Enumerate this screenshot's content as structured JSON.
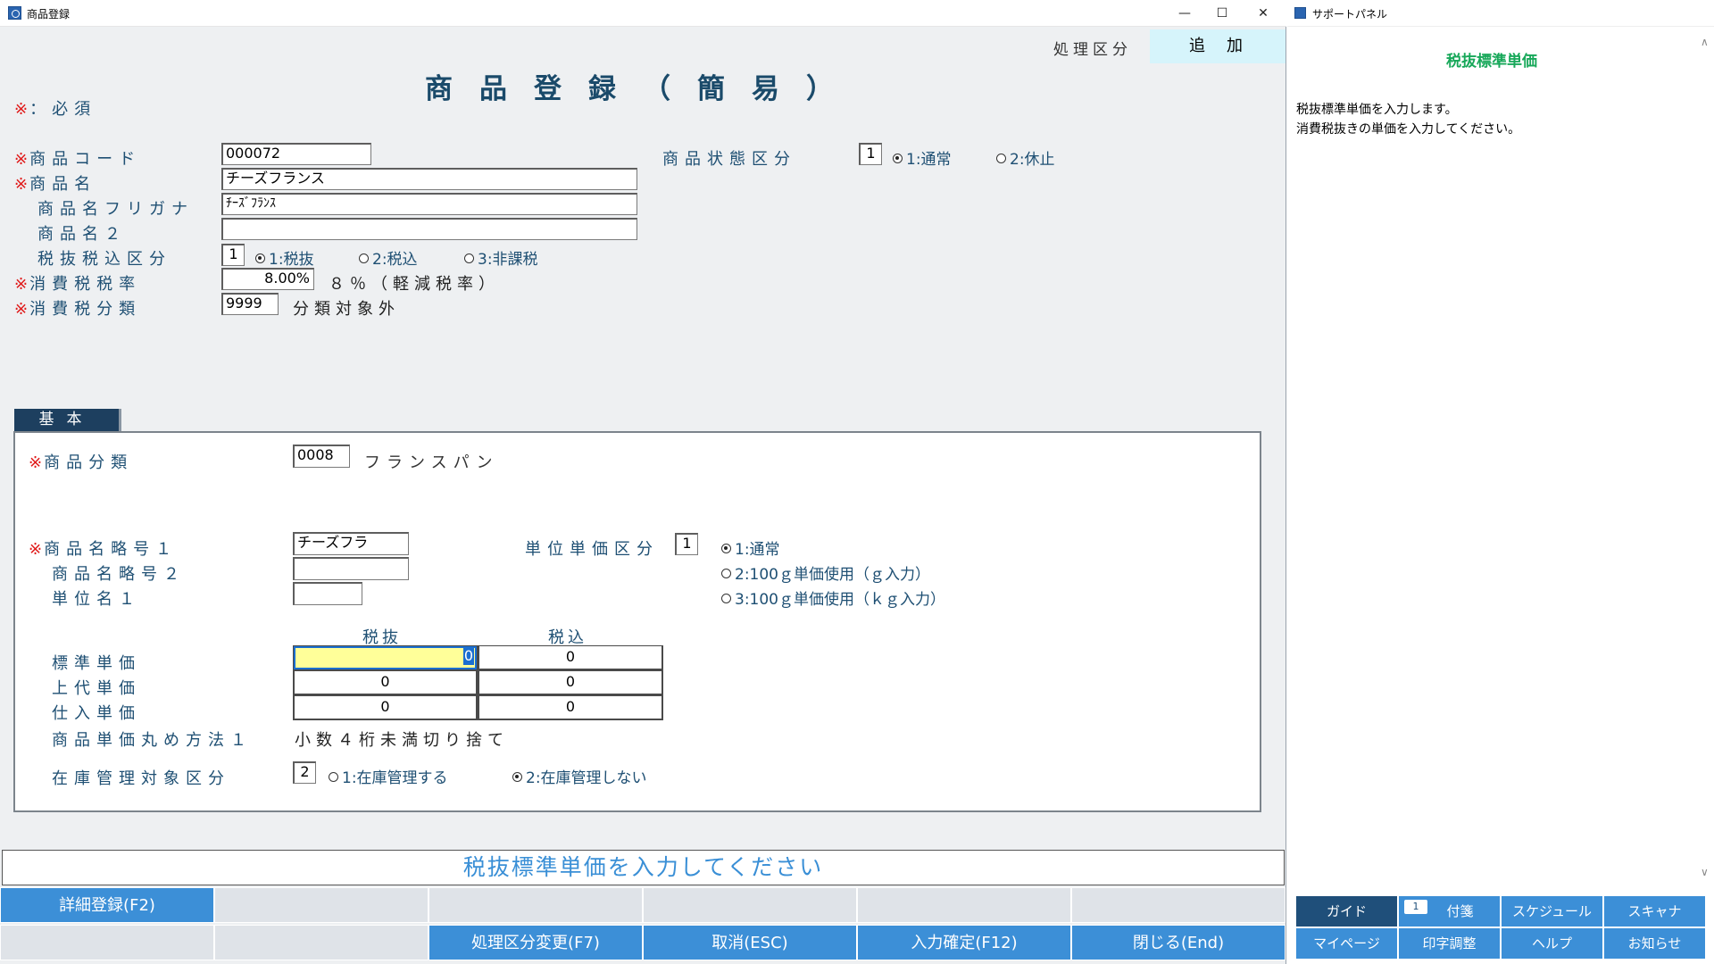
{
  "window": {
    "title": "商品登録"
  },
  "mode": {
    "label": "処理区分",
    "value": "追加"
  },
  "form_title": "商品登録（簡易）",
  "required_note": "：必須",
  "required_mark": "※",
  "header_fields": {
    "code_label": "商品コード",
    "code_value": "000072",
    "name_label": "商品名",
    "name_value": "チーズフランス",
    "kana_label": "商品名フリガナ",
    "kana_value": "ﾁｰｽﾞﾌﾗﾝｽ",
    "name2_label": "商品名２",
    "name2_value": "",
    "taxmode_label": "税抜税込区分",
    "taxmode_value": "1",
    "taxmode_opt1": "1:税抜",
    "taxmode_opt2": "2:税込",
    "taxmode_opt3": "3:非課税",
    "taxrate_label": "消費税税率",
    "taxrate_value": "8.00%",
    "taxrate_desc": "８％（軽減税率）",
    "taxcat_label": "消費税分類",
    "taxcat_value": "9999",
    "taxcat_desc": "分類対象外",
    "status_label": "商品状態区分",
    "status_value": "1",
    "status_opt1": "1:通常",
    "status_opt2": "2:休止"
  },
  "tab": {
    "label": "基本"
  },
  "basic": {
    "category_label": "商品分類",
    "category_value": "0008",
    "category_desc": "フランスパン",
    "abbr1_label": "商品名略号１",
    "abbr1_value": "チーズフラ",
    "abbr2_label": "商品名略号２",
    "abbr2_value": "",
    "unit1_label": "単位名１",
    "unit1_value": "",
    "unitprice_label": "単位単価区分",
    "unitprice_value": "1",
    "unitprice_opt1": "1:通常",
    "unitprice_opt2": "2:100ｇ単価使用（ｇ入力）",
    "unitprice_opt3": "3:100ｇ単価使用（ｋｇ入力）",
    "col_excl": "税抜",
    "col_incl": "税込",
    "price_rows": [
      {
        "label": "標準単価",
        "excl": "0",
        "incl": "0"
      },
      {
        "label": "上代単価",
        "excl": "0",
        "incl": "0"
      },
      {
        "label": "仕入単価",
        "excl": "0",
        "incl": "0"
      }
    ],
    "rounding_label": "商品単価丸め方法１",
    "rounding_value": "小数４桁未満切り捨て",
    "stock_label": "在庫管理対象区分",
    "stock_value": "2",
    "stock_opt1": "1:在庫管理する",
    "stock_opt2": "2:在庫管理しない"
  },
  "message": "税抜標準単価を入力してください",
  "fkeys": {
    "detail": "詳細登録(F2)",
    "change_mode": "処理区分変更(F7)",
    "cancel": "取消(ESC)",
    "confirm": "入力確定(F12)",
    "close": "閉じる(End)"
  },
  "support": {
    "title": "サポートパネル",
    "heading": "税抜標準単価",
    "line1": "税抜標準単価を入力します。",
    "line2": "消費税抜きの単価を入力してください。",
    "buttons": [
      "ガイド",
      "付箋",
      "スケジュール",
      "スキャナ",
      "マイページ",
      "印字調整",
      "ヘルプ",
      "お知らせ"
    ],
    "sticky_badge": "1"
  },
  "colors": {
    "accent": "#3c8fd7",
    "label": "#1e4f73",
    "required": "#e01b1b",
    "active_field": "#ffff99",
    "support_heading": "#18a85a"
  }
}
